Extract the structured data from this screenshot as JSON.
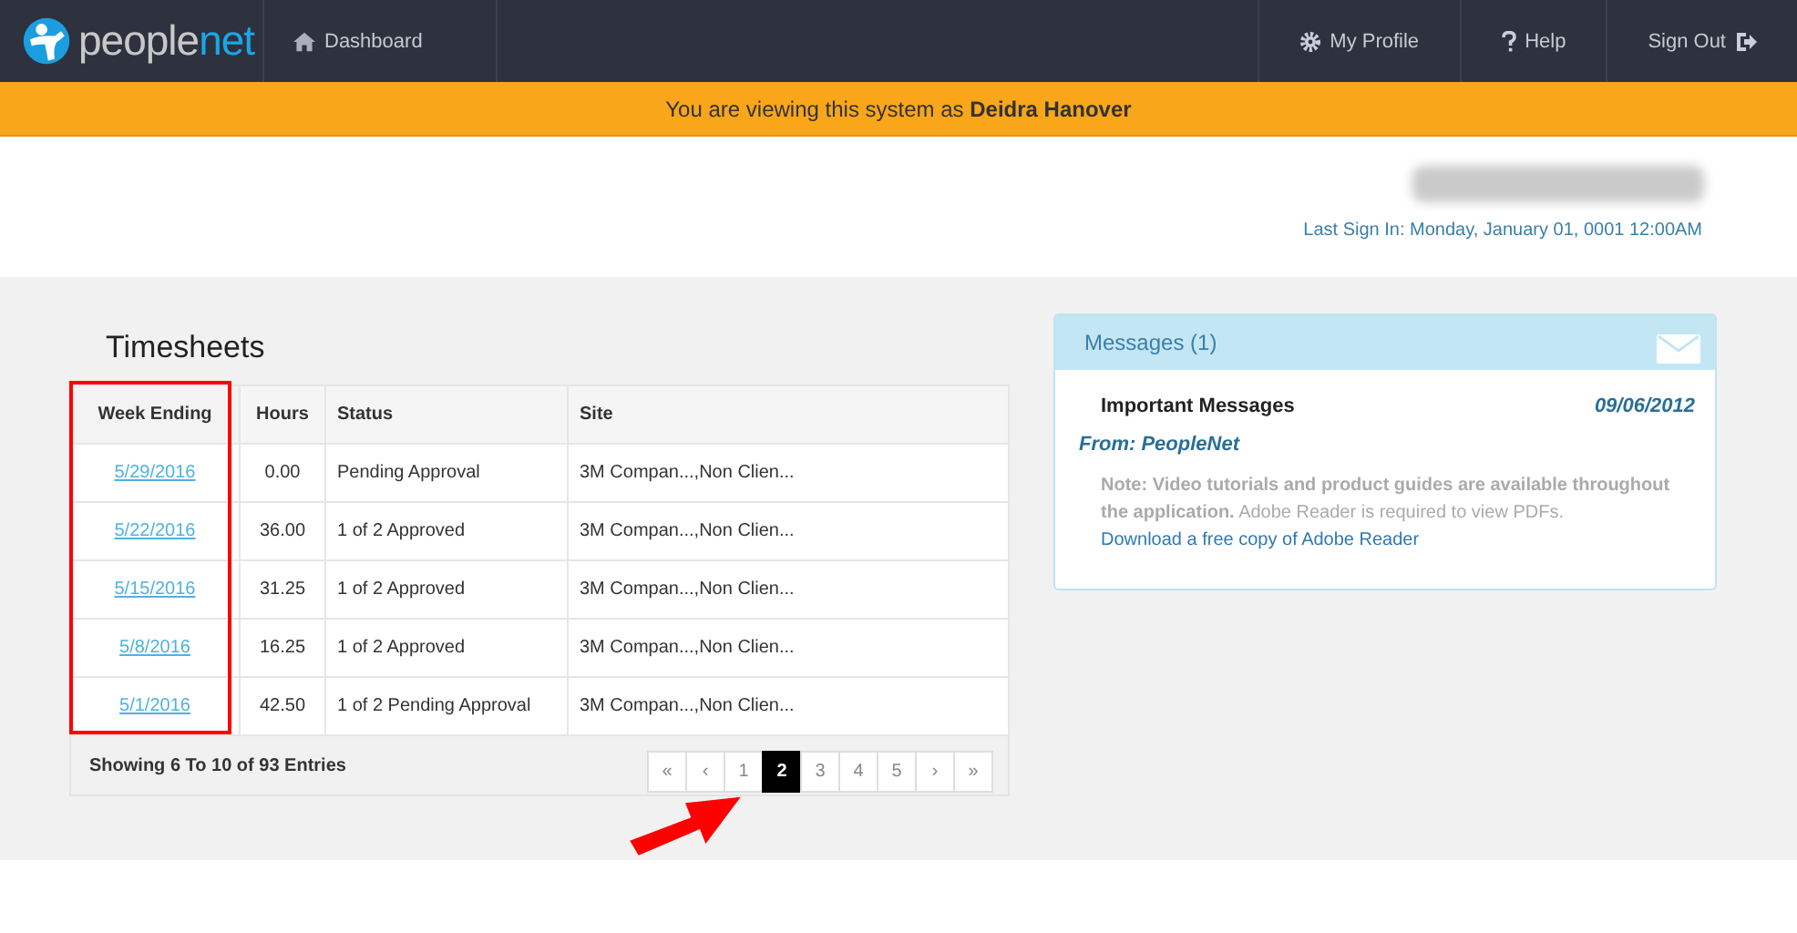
{
  "nav": {
    "brand": {
      "plain": "people",
      "accent": "net"
    },
    "items": [
      {
        "label": "Dashboard",
        "kind": "home"
      }
    ],
    "right_items": [
      {
        "label": "My Profile",
        "kind": "profile"
      },
      {
        "label": "Help",
        "kind": "help"
      },
      {
        "label": "Sign Out",
        "kind": "signout"
      }
    ]
  },
  "impersonation_banner": "You are viewing this system as **Deidra Hanover**",
  "user": {
    "last_sign_in": "Last Sign In: Monday, January 01, 0001 12:00AM"
  },
  "timesheets": {
    "title": "Timesheets",
    "columns": [
      "Week Ending",
      "Hours",
      "Status",
      "Site"
    ],
    "rows": [
      {
        "week_ending": "5/29/2016",
        "hours": "0.00",
        "status": "Pending Approval",
        "site": "3M Compan...,Non Clien..."
      },
      {
        "week_ending": "5/22/2016",
        "hours": "36.00",
        "status": "1 of 2 Approved",
        "site": "3M Compan...,Non Clien..."
      },
      {
        "week_ending": "5/15/2016",
        "hours": "31.25",
        "status": "1 of 2 Approved",
        "site": "3M Compan...,Non Clien..."
      },
      {
        "week_ending": "5/8/2016",
        "hours": "16.25",
        "status": "1 of 2 Approved",
        "site": "3M Compan...,Non Clien..."
      },
      {
        "week_ending": "5/1/2016",
        "hours": "42.50",
        "status": "1 of 2 Pending Approval",
        "site": "3M Compan...,Non Clien..."
      }
    ],
    "summary": "Showing 6 To 10 of 93 Entries",
    "pagination": [
      {
        "label": "«",
        "selected": false
      },
      {
        "label": "‹",
        "selected": false
      },
      {
        "label": "1",
        "selected": false
      },
      {
        "label": "2",
        "selected": true
      },
      {
        "label": "3",
        "selected": false
      },
      {
        "label": "4",
        "selected": false
      },
      {
        "label": "5",
        "selected": false
      },
      {
        "label": "›",
        "selected": false
      },
      {
        "label": "»",
        "selected": false
      }
    ]
  },
  "messages": {
    "title": "Messages (1)",
    "items": [
      {
        "subject": "Important Messages",
        "date": "09/06/2012",
        "from": "From: PeopleNet",
        "body": "**Note: Video tutorials and product guides are available throughout the application.** Adobe Reader is required to view PDFs.",
        "link": "Download a free copy of Adobe Reader"
      }
    ]
  }
}
